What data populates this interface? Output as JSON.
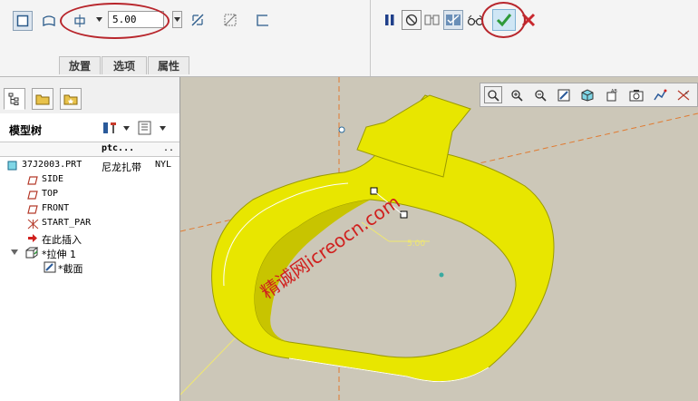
{
  "ribbon": {
    "depth_value": "5.00",
    "tabs": [
      {
        "label": "放置"
      },
      {
        "label": "选项"
      },
      {
        "label": "属性"
      }
    ],
    "highlight_color": "#b8262c",
    "accept_color": "#2f9a3a",
    "cancel_color": "#c8282e"
  },
  "nav": {
    "tabs": [
      "model-tree-tab",
      "folder-browser-tab",
      "favorites-tab"
    ]
  },
  "tree": {
    "title": "模型树",
    "columns": [
      "ptc...",
      ".."
    ],
    "items": [
      {
        "label": "37J2003.PRT",
        "col1": "尼龙扎带",
        "col2": "NYL",
        "icon": "part-icon"
      },
      {
        "label": "SIDE",
        "icon": "datum-plane-icon"
      },
      {
        "label": "TOP",
        "icon": "datum-plane-icon"
      },
      {
        "label": "FRONT",
        "icon": "datum-plane-icon"
      },
      {
        "label": "START_PAR",
        "icon": "coordinate-system-icon"
      },
      {
        "label": "在此插入",
        "icon": "insert-arrow-icon"
      },
      {
        "label": "*拉伸 1",
        "icon": "extrude-icon"
      },
      {
        "label": "*截面",
        "icon": "sketch-icon"
      }
    ]
  },
  "viewport": {
    "background": "#ccc7b8",
    "model_color": "#e8e600",
    "dimension_label": "5.00",
    "watermark": "精诚网icreocn.com"
  }
}
